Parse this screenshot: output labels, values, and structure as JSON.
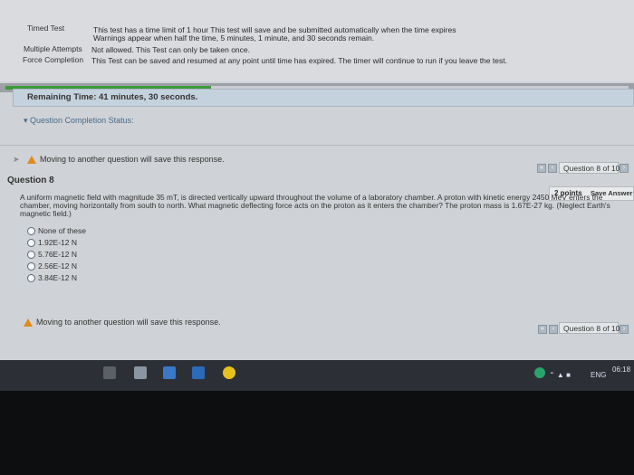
{
  "test_info": {
    "timed_test_label": "Timed Test",
    "timed_test_line1": "This test has a time limit of 1 hour This test will save and be submitted automatically when the time expires",
    "timed_test_line2": "Warnings appear when half the time, 5 minutes, 1 minute, and 30 seconds remain.",
    "multiple_attempts_label": "Multiple Attempts",
    "multiple_attempts_value": "Not allowed. This Test can only be taken once.",
    "force_completion_label": "Force Completion",
    "force_completion_value": "This Test can be saved and resumed at any point until time has expired. The timer will continue to run if you leave the test."
  },
  "timer": {
    "remaining": "Remaining Time: 41 minutes, 30 seconds.",
    "progress_fraction": 0.33
  },
  "completion_status": "Question Completion Status:",
  "warning_text": "Moving to another question will save this response.",
  "question_nav": {
    "label_top": "Question 8 of 10",
    "label_bottom": "Question 8 of 10"
  },
  "question": {
    "title": "Question 8",
    "points": "2 points",
    "save_answer": "Save Answer",
    "text": "A uniform magnetic field with magnitude 35 mT, is directed vertically upward throughout the volume of a laboratory chamber. A proton with kinetic energy 2450 MeV enters the chamber, moving horizontally from south to north. What magnetic deflecting force acts on the proton as it enters the chamber? The proton mass is 1.67E-27 kg. (Neglect Earth's magnetic field.)",
    "options": [
      "None of these",
      "1.92E-12 N",
      "5.76E-12 N",
      "2.56E-12 N",
      "3.84E-12 N"
    ]
  },
  "taskbar": {
    "language": "ENG",
    "time": "06:18"
  },
  "colors": {
    "progress": "#3a9a3a",
    "warning": "#e08a1a",
    "taskbar": "#2c3036"
  }
}
